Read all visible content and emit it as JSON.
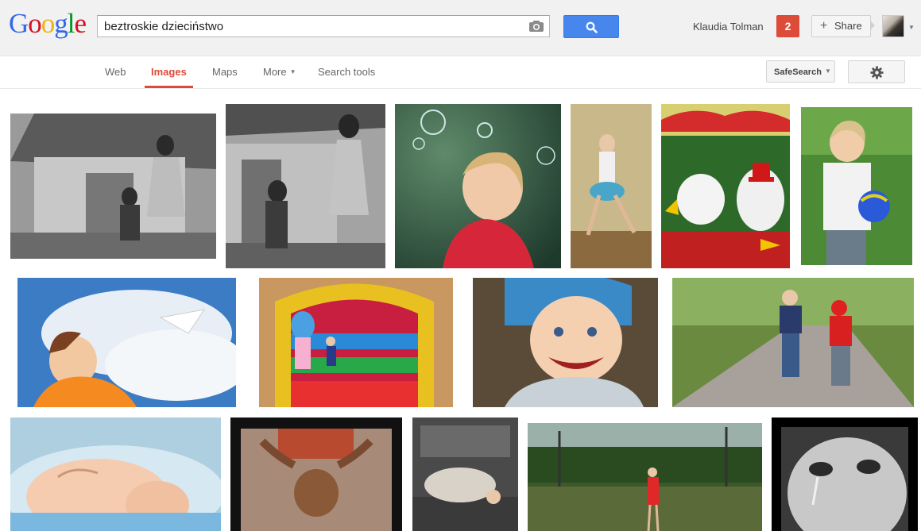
{
  "logo": {
    "letters": [
      "G",
      "o",
      "o",
      "g",
      "l",
      "e"
    ],
    "colors": [
      "#3369e8",
      "#d50f25",
      "#eeb211",
      "#3369e8",
      "#009925",
      "#d50f25"
    ]
  },
  "search": {
    "query": "beztroskie dzieciństwo"
  },
  "header": {
    "username": "Klaudia Tolman",
    "notifications": "2",
    "share_label": "Share"
  },
  "nav": {
    "items": [
      {
        "label": "Web"
      },
      {
        "label": "Images"
      },
      {
        "label": "Maps"
      },
      {
        "label": "More"
      },
      {
        "label": "Search tools"
      }
    ],
    "active": "Images",
    "safesearch_label": "SafeSearch"
  },
  "colors": {
    "accent_red": "#dd4b39",
    "search_blue": "#4787ed"
  },
  "results": {
    "images": [
      {
        "desc": "bw-girls-barn"
      },
      {
        "desc": "bw-girls-barn-2"
      },
      {
        "desc": "toddler-bubbles"
      },
      {
        "desc": "girl-dancing"
      },
      {
        "desc": "carousel-ducks"
      },
      {
        "desc": "boy-ball"
      },
      {
        "desc": "boy-paper-plane"
      },
      {
        "desc": "bouncy-castle"
      },
      {
        "desc": "smiling-baby"
      },
      {
        "desc": "kids-running-road"
      },
      {
        "desc": "sleeping-baby"
      },
      {
        "desc": "boy-carrying-bricks"
      },
      {
        "desc": "dog-sleeping"
      },
      {
        "desc": "girl-rails"
      },
      {
        "desc": "crying-child-bw"
      }
    ]
  }
}
